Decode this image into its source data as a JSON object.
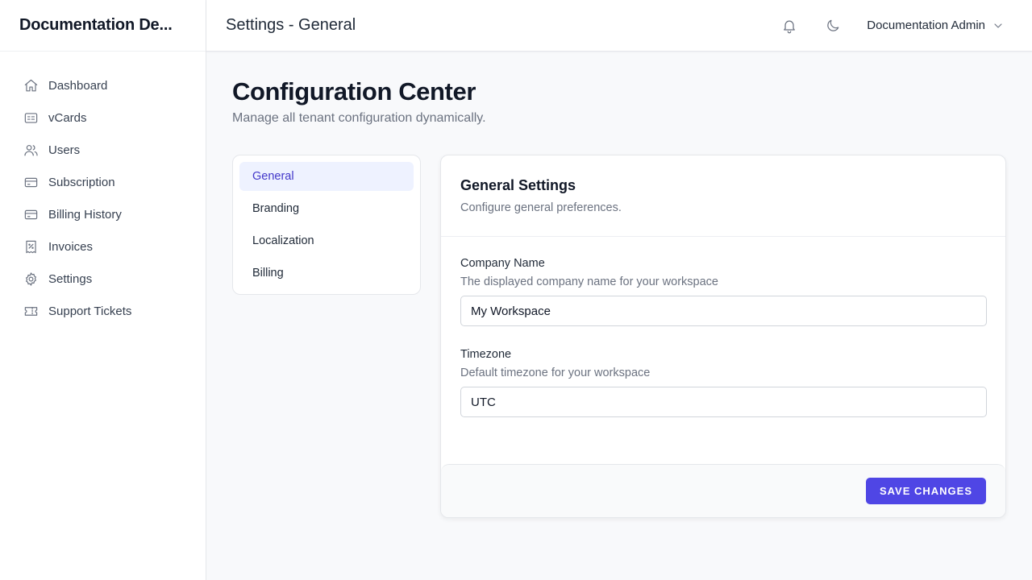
{
  "brand": {
    "name": "Documentation De..."
  },
  "sidebar": {
    "items": [
      {
        "label": "Dashboard",
        "icon": "home-icon"
      },
      {
        "label": "vCards",
        "icon": "id-card-icon"
      },
      {
        "label": "Users",
        "icon": "users-icon"
      },
      {
        "label": "Subscription",
        "icon": "credit-card-icon"
      },
      {
        "label": "Billing History",
        "icon": "credit-card-icon"
      },
      {
        "label": "Invoices",
        "icon": "receipt-icon"
      },
      {
        "label": "Settings",
        "icon": "gear-icon"
      },
      {
        "label": "Support Tickets",
        "icon": "ticket-icon"
      }
    ]
  },
  "topbar": {
    "title": "Settings - General",
    "user_name": "Documentation Admin",
    "icons": [
      "bell-icon",
      "moon-icon",
      "chevron-down-icon"
    ]
  },
  "page": {
    "title": "Configuration Center",
    "subtitle": "Manage all tenant configuration dynamically."
  },
  "tabs": [
    {
      "label": "General",
      "active": true
    },
    {
      "label": "Branding",
      "active": false
    },
    {
      "label": "Localization",
      "active": false
    },
    {
      "label": "Billing",
      "active": false
    }
  ],
  "settings": {
    "title": "General Settings",
    "description": "Configure general preferences.",
    "fields": [
      {
        "label": "Company Name",
        "description": "The displayed company name for your workspace",
        "value": "My Workspace"
      },
      {
        "label": "Timezone",
        "description": "Default timezone for your workspace",
        "value": "UTC"
      }
    ],
    "save_label": "SAVE CHANGES"
  },
  "colors": {
    "accent": "#4f46e5",
    "active_tab_bg": "#eef2ff",
    "active_tab_text": "#4338ca"
  }
}
